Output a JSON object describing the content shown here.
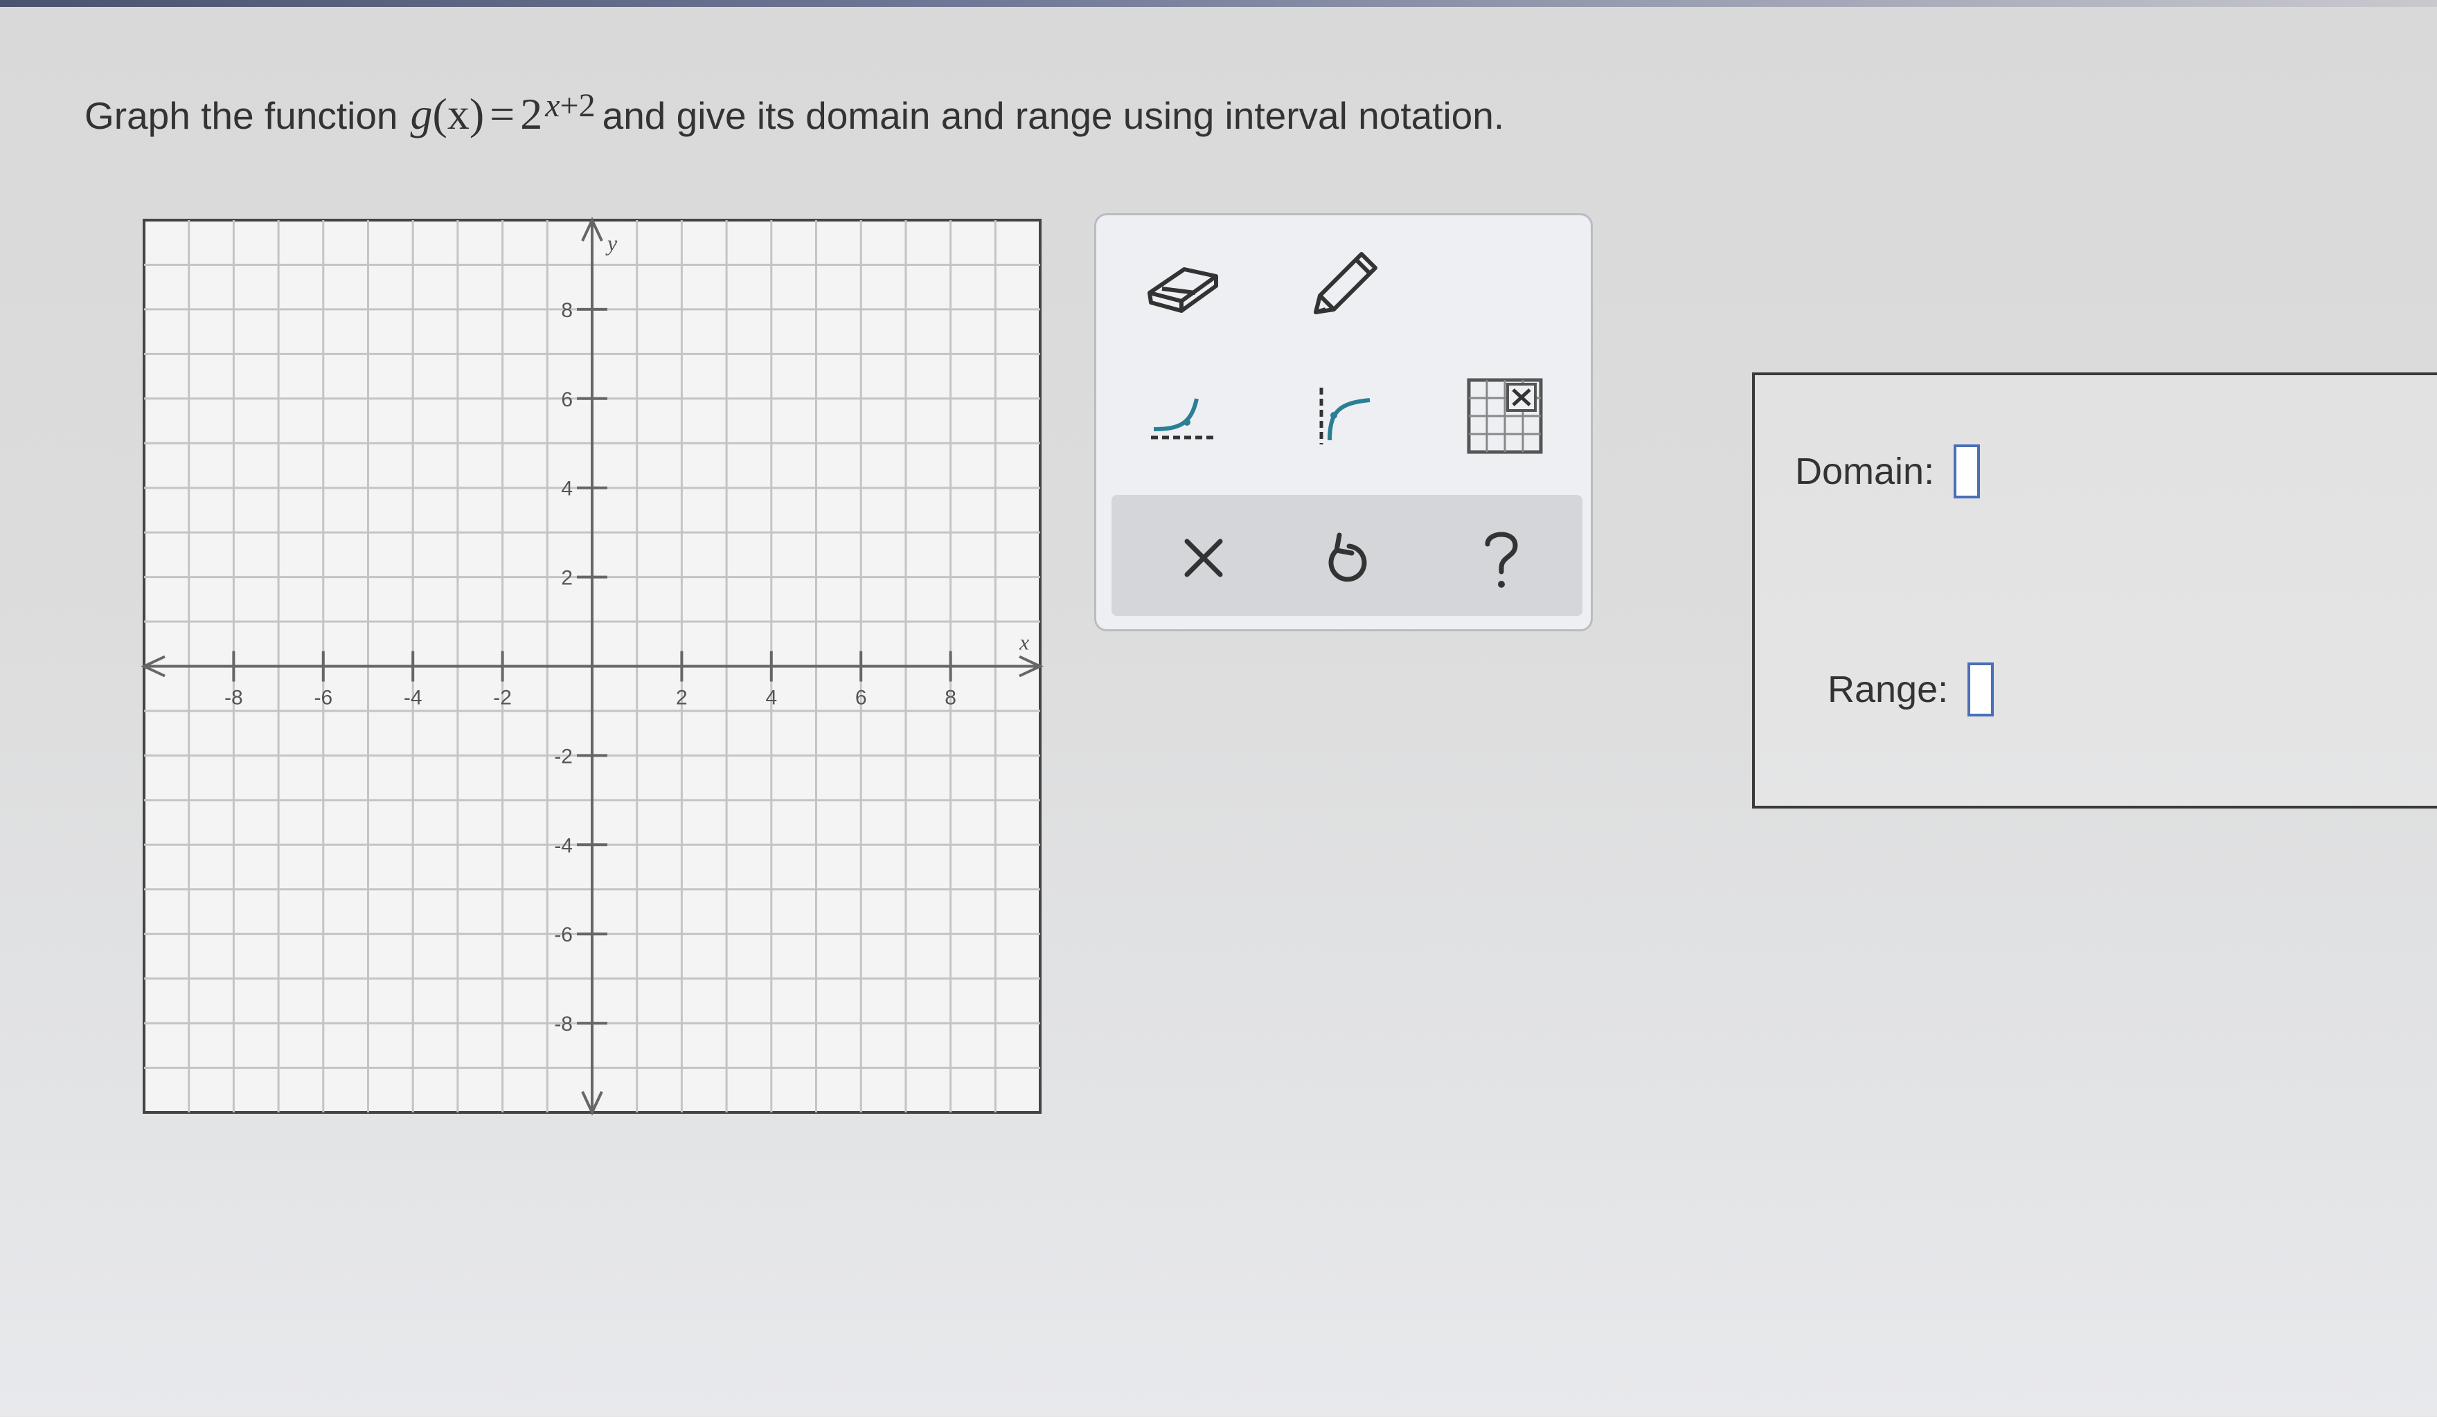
{
  "question": {
    "prefix": "Graph the function",
    "func_name": "g",
    "func_arg": "(x)",
    "equals": "=",
    "base": "2",
    "exponent_var": "x",
    "exponent_rest": "+2",
    "suffix": "and give its domain and range using interval notation."
  },
  "graph": {
    "x_axis_label": "x",
    "y_axis_label": "y",
    "x_ticks": [
      "-8",
      "-6",
      "-4",
      "-2",
      "2",
      "4",
      "6",
      "8"
    ],
    "y_ticks": [
      "8",
      "6",
      "4",
      "2",
      "-2",
      "-4",
      "-6",
      "-8"
    ],
    "x_range": [
      -10,
      10
    ],
    "y_range": [
      -10,
      10
    ]
  },
  "tools": {
    "eraser": "eraser-icon",
    "pencil": "pencil-icon",
    "exponential": "exponential-curve-icon",
    "logarithmic": "logarithmic-curve-icon",
    "no_solution": "no-solution-grid-icon",
    "clear": "close-icon",
    "undo": "undo-icon",
    "help": "help-icon",
    "accent_color": "#2a7f95",
    "icon_color": "#333333"
  },
  "answers": {
    "domain_label": "Domain:",
    "range_label": "Range:",
    "domain_value": "",
    "range_value": "",
    "input_border_color": "#4a6fb8"
  }
}
